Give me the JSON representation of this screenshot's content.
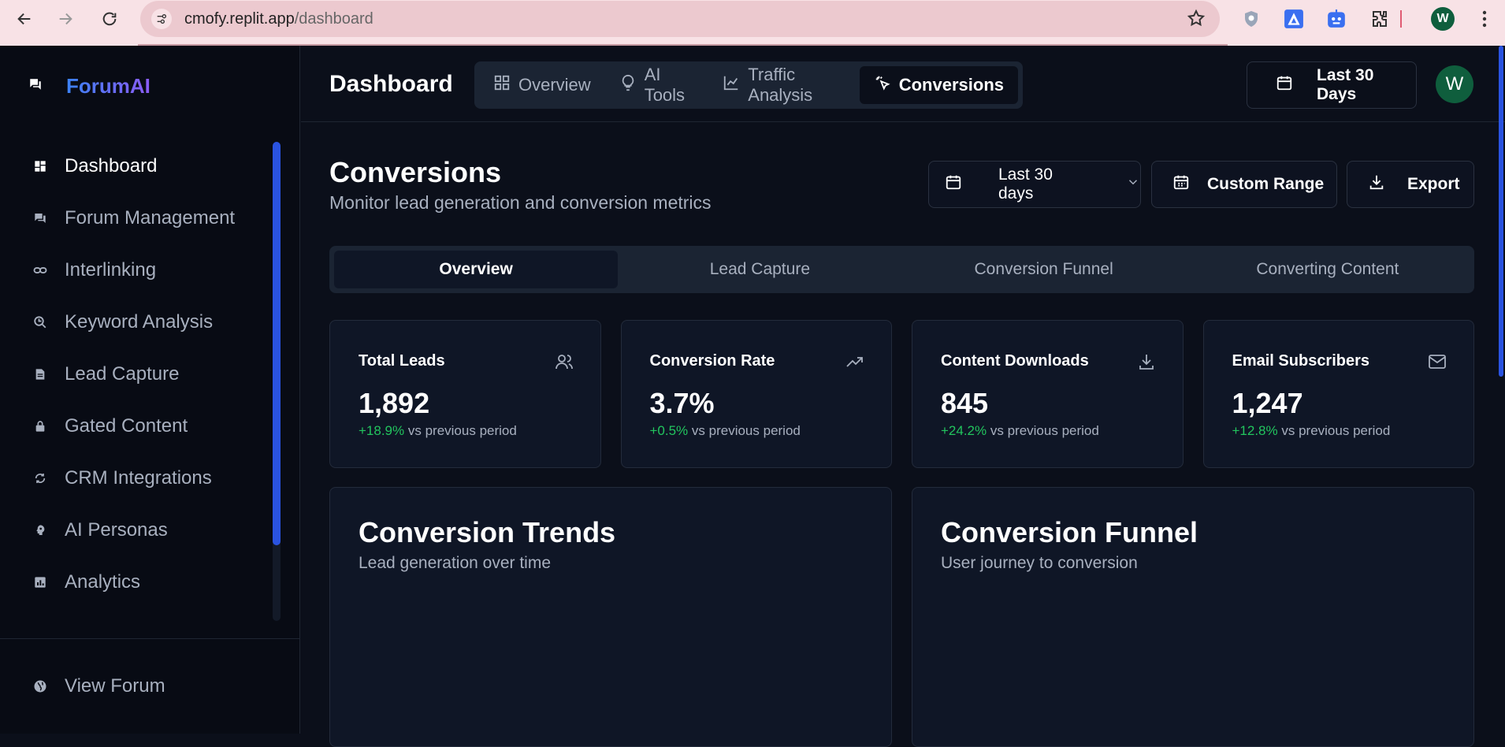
{
  "browser": {
    "url_domain": "cmofy.replit.app",
    "url_path": "/dashboard",
    "profile_initial": "W"
  },
  "sidebar": {
    "brand": "ForumAI",
    "items": [
      {
        "label": "Dashboard",
        "icon": "dashboard-icon",
        "active": true
      },
      {
        "label": "Forum Management",
        "icon": "forum-icon"
      },
      {
        "label": "Interlinking",
        "icon": "link-icon"
      },
      {
        "label": "Keyword Analysis",
        "icon": "keyword-search-icon"
      },
      {
        "label": "Lead Capture",
        "icon": "document-icon"
      },
      {
        "label": "Gated Content",
        "icon": "lock-icon"
      },
      {
        "label": "CRM Integrations",
        "icon": "sync-icon"
      },
      {
        "label": "AI Personas",
        "icon": "persona-icon"
      },
      {
        "label": "Analytics",
        "icon": "analytics-icon"
      }
    ],
    "footer": {
      "label": "View Forum",
      "icon": "globe-icon"
    }
  },
  "header": {
    "title": "Dashboard",
    "tabs": [
      {
        "label": "Overview",
        "icon": "grid-icon"
      },
      {
        "label": "AI Tools",
        "icon": "lightbulb-icon"
      },
      {
        "label": "Traffic Analysis",
        "icon": "line-chart-icon"
      },
      {
        "label": "Conversions",
        "icon": "cursor-click-icon",
        "active": true
      }
    ],
    "date_range": "Last 30 Days",
    "avatar_initial": "W"
  },
  "main": {
    "title": "Conversions",
    "subtitle": "Monitor lead generation and conversion metrics",
    "period_select": "Last 30 days",
    "custom_range_label": "Custom Range",
    "export_label": "Export",
    "subtabs": [
      {
        "label": "Overview",
        "active": true
      },
      {
        "label": "Lead Capture"
      },
      {
        "label": "Conversion Funnel"
      },
      {
        "label": "Converting Content"
      }
    ],
    "stats": [
      {
        "label": "Total Leads",
        "value": "1,892",
        "delta": "+18.9%",
        "suffix": " vs previous period",
        "icon": "users-icon"
      },
      {
        "label": "Conversion Rate",
        "value": "3.7%",
        "delta": "+0.5%",
        "suffix": " vs previous period",
        "icon": "trending-up-icon"
      },
      {
        "label": "Content Downloads",
        "value": "845",
        "delta": "+24.2%",
        "suffix": " vs previous period",
        "icon": "download-icon"
      },
      {
        "label": "Email Subscribers",
        "value": "1,247",
        "delta": "+12.8%",
        "suffix": " vs previous period",
        "icon": "mail-icon"
      }
    ],
    "panels": [
      {
        "title": "Conversion Trends",
        "subtitle": "Lead generation over time"
      },
      {
        "title": "Conversion Funnel",
        "subtitle": "User journey to conversion"
      }
    ]
  },
  "colors": {
    "accent": "#2a53e0",
    "positive": "#22c55e",
    "background": "#0b0f1a",
    "card": "#0f1626"
  }
}
